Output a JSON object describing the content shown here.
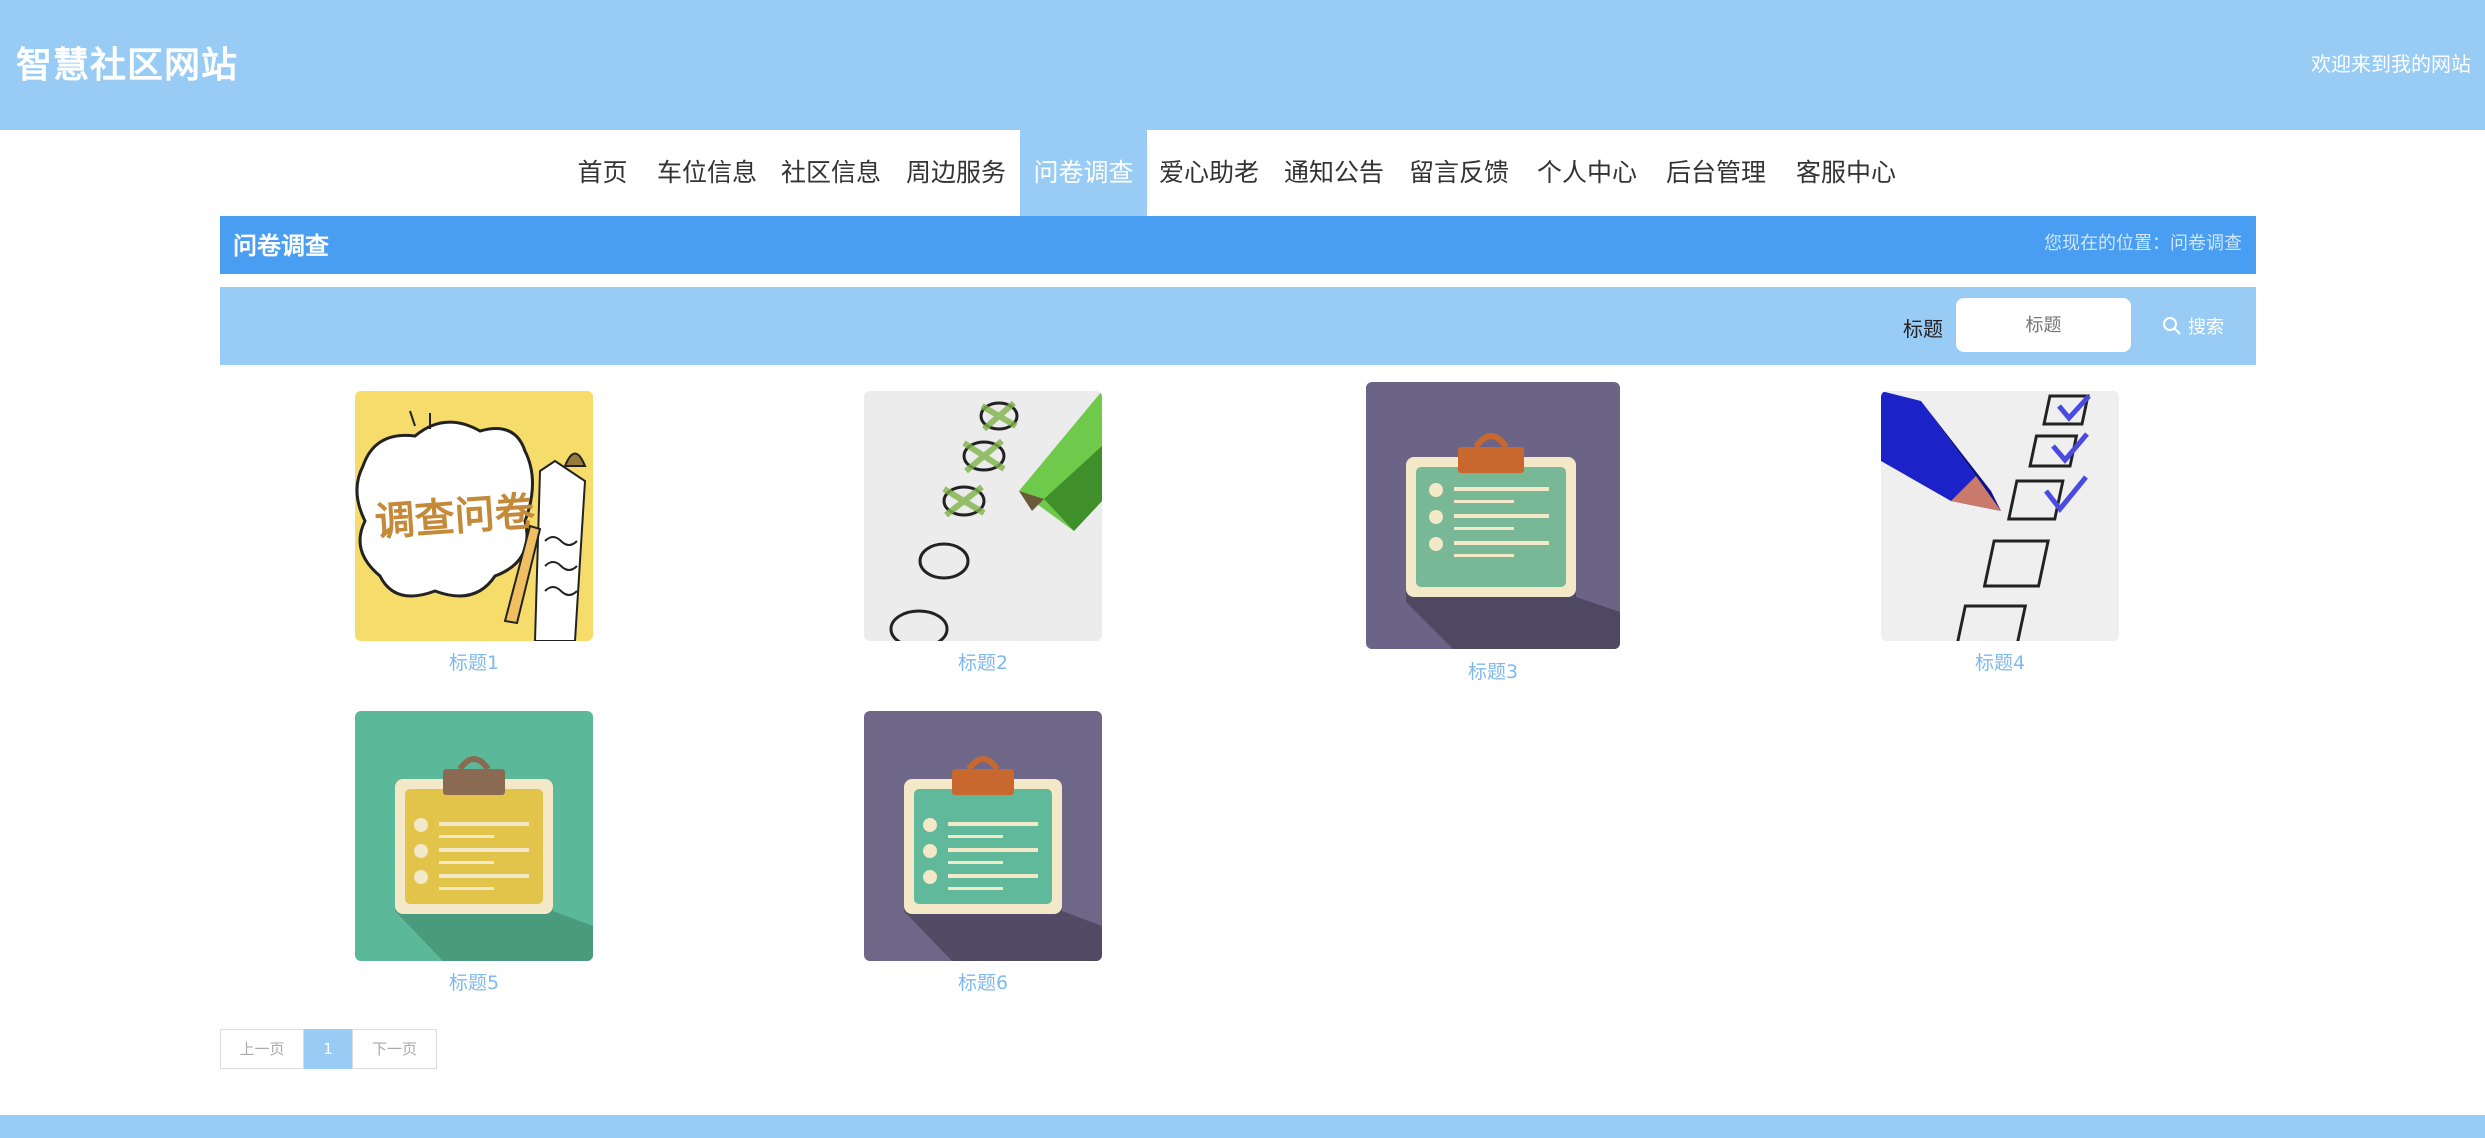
{
  "header": {
    "site_title": "智慧社区网站",
    "welcome": "欢迎来到我的网站"
  },
  "nav": {
    "items": [
      "首页",
      "车位信息",
      "社区信息",
      "周边服务",
      "问卷调查",
      "爱心助老",
      "通知公告",
      "留言反馈",
      "个人中心",
      "后台管理",
      "客服中心"
    ],
    "active": "问卷调查"
  },
  "breadcrumb": {
    "title": "问卷调查",
    "location": "您现在的位置：问卷调查"
  },
  "search": {
    "label": "标题",
    "placeholder": "标题",
    "button": "搜索"
  },
  "cards": [
    {
      "label": "标题1",
      "image_text": "调查问卷"
    },
    {
      "label": "标题2"
    },
    {
      "label": "标题3"
    },
    {
      "label": "标题4"
    },
    {
      "label": "标题5"
    },
    {
      "label": "标题6"
    }
  ],
  "pagination": {
    "prev": "上一页",
    "current": "1",
    "next": "下一页"
  },
  "colors": {
    "header_bg": "#99ccf5",
    "crumb_bg": "#4a9ef2",
    "link": "#7fb9ee"
  }
}
